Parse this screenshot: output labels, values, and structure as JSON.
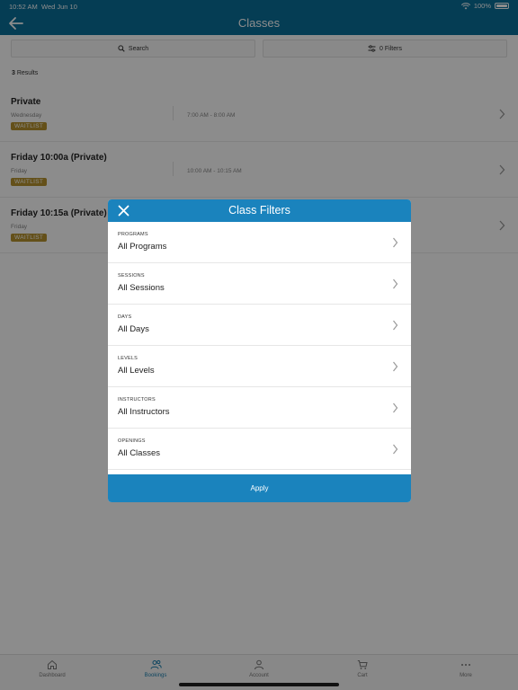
{
  "status_bar": {
    "time": "10:52 AM",
    "date": "Wed Jun 10",
    "battery": "100%"
  },
  "header": {
    "title": "Classes"
  },
  "search": {
    "label": "Search"
  },
  "filters_button": {
    "label": "0 Filters"
  },
  "results": {
    "count": "3",
    "label": "Results"
  },
  "classes": [
    {
      "name": "Private",
      "day": "Wednesday",
      "time": "7:00 AM - 8:00 AM",
      "badge": "WAITLIST"
    },
    {
      "name": "Friday 10:00a (Private)",
      "day": "Friday",
      "time": "10:00 AM - 10:15 AM",
      "badge": "WAITLIST"
    },
    {
      "name": "Friday 10:15a (Private)",
      "day": "Friday",
      "time": "",
      "badge": "WAITLIST"
    }
  ],
  "modal": {
    "title": "Class Filters",
    "filters": [
      {
        "label": "PROGRAMS",
        "value": "All Programs"
      },
      {
        "label": "SESSIONS",
        "value": "All Sessions"
      },
      {
        "label": "DAYS",
        "value": "All Days"
      },
      {
        "label": "LEVELS",
        "value": "All Levels"
      },
      {
        "label": "INSTRUCTORS",
        "value": "All Instructors"
      },
      {
        "label": "OPENINGS",
        "value": "All Classes"
      }
    ],
    "apply_label": "Apply"
  },
  "tabs": [
    {
      "label": "Dashboard",
      "icon": "home-icon"
    },
    {
      "label": "Bookings",
      "icon": "people-icon",
      "active": true
    },
    {
      "label": "Account",
      "icon": "person-icon"
    },
    {
      "label": "Cart",
      "icon": "cart-icon"
    },
    {
      "label": "More",
      "icon": "more-icon"
    }
  ],
  "colors": {
    "header": "#0a6f9a",
    "modal_accent": "#1a83bd",
    "badge": "#b6932e",
    "active_tab": "#1a7fb0"
  }
}
